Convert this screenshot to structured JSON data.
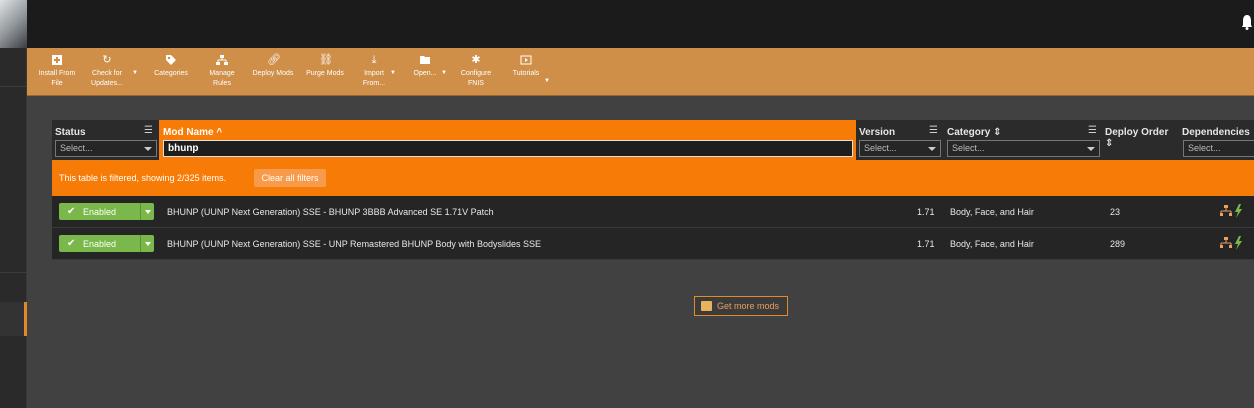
{
  "toolbar": {
    "buttons": [
      {
        "label": "Install From File",
        "icon": "plus-icon"
      },
      {
        "label": "Check for Updates...",
        "icon": "refresh-icon"
      },
      {
        "label": "Categories",
        "icon": "tag-icon"
      },
      {
        "label": "Manage Rules",
        "icon": "rules-icon"
      },
      {
        "label": "Deploy Mods",
        "icon": "link-icon"
      },
      {
        "label": "Purge Mods",
        "icon": "unlink-icon"
      },
      {
        "label": "Import From...",
        "icon": "import-icon"
      },
      {
        "label": "Open...",
        "icon": "folder-icon"
      },
      {
        "label": "Configure FNIS",
        "icon": "gear-icon"
      },
      {
        "label": "Tutorials",
        "icon": "video-icon"
      }
    ]
  },
  "table": {
    "columns": {
      "status": "Status",
      "mod_name": "Mod Name",
      "version": "Version",
      "category": "Category",
      "deploy_order": "Deploy Order",
      "dependencies": "Dependencies"
    },
    "select_placeholder": "Select...",
    "name_filter_value": "bhunp",
    "filter_message": "This table is filtered, showing 2/325 items.",
    "clear_filters_label": "Clear all filters",
    "rows": [
      {
        "status": "Enabled",
        "name": "BHUNP (UUNP Next Generation) SSE - BHUNP 3BBB Advanced SE 1.71V Patch",
        "version": "1.71",
        "category": "Body, Face, and Hair",
        "deploy_order": "23"
      },
      {
        "status": "Enabled",
        "name": "BHUNP (UUNP Next Generation) SSE - UNP Remastered BHUNP Body with Bodyslides SSE",
        "version": "1.71",
        "category": "Body, Face, and Hair",
        "deploy_order": "289"
      }
    ]
  },
  "get_more_label": "Get more mods",
  "colors": {
    "accent": "#f77b07",
    "toolbar": "#cf8f48",
    "enabled": "#7ab84b"
  }
}
